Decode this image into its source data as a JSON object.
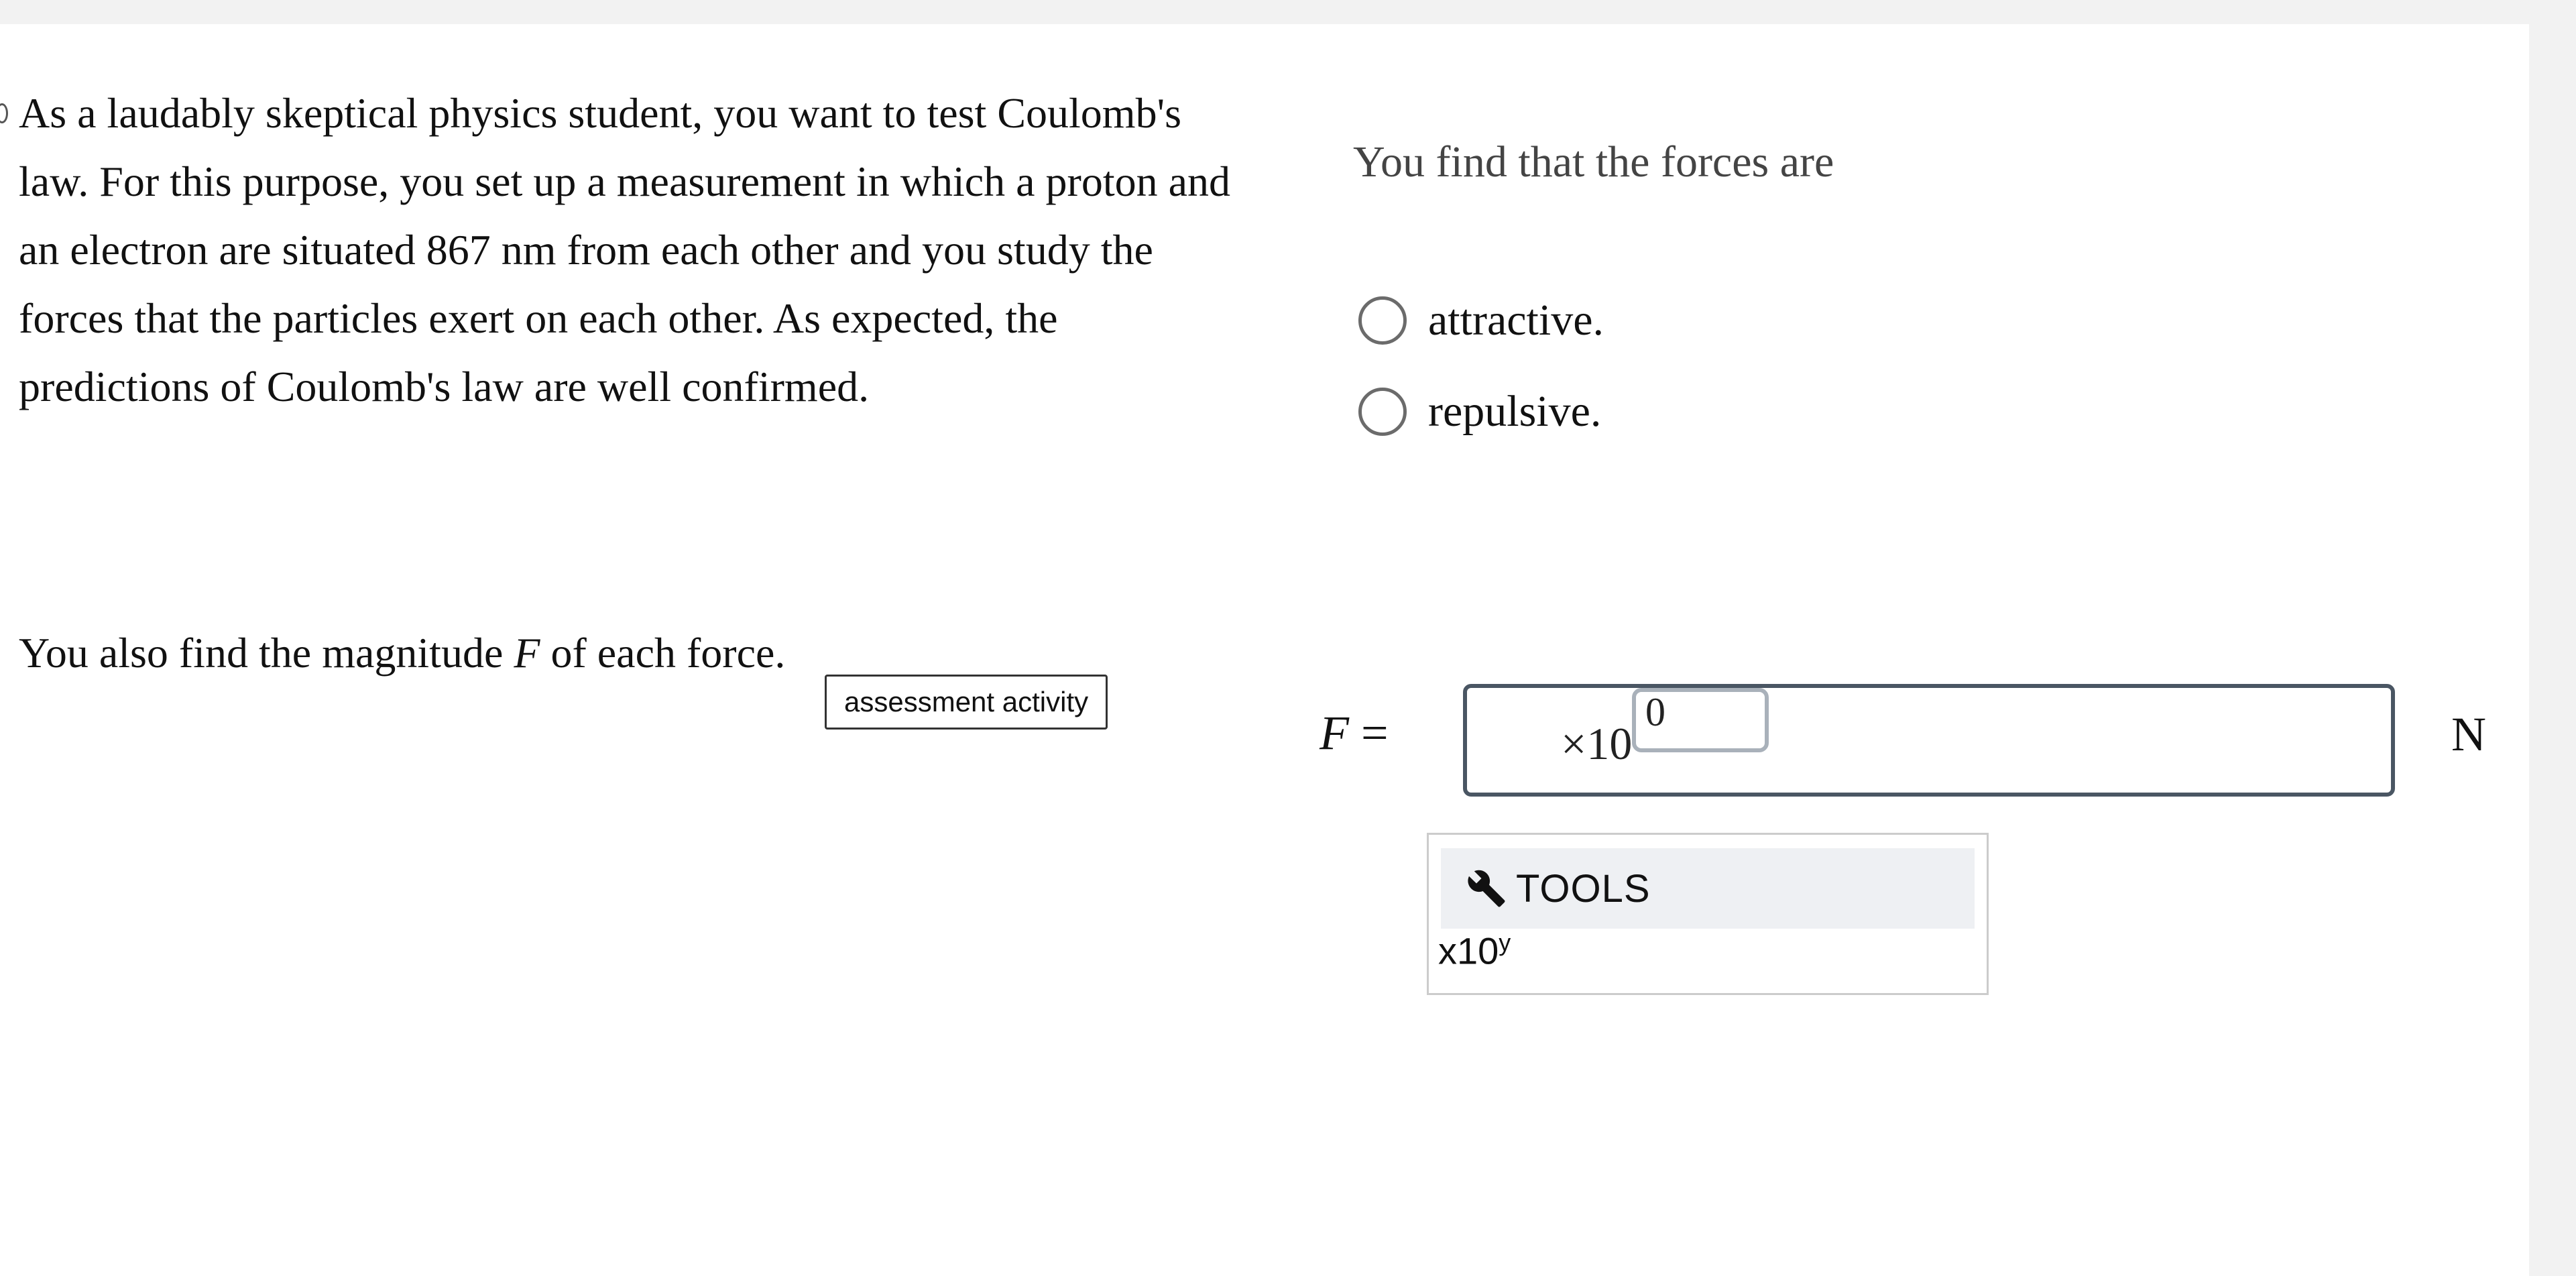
{
  "question": {
    "paragraph": "As a laudably skeptical physics student, you want to test Coulomb's law. For this purpose, you set up a measurement in which a proton and an electron are situated 867 nm from each other and you study the forces that the particles exert on each other. As expected, the predictions of Coulomb's law are well confirmed.",
    "magnitude_before": "You also find the magnitude ",
    "magnitude_var": "F",
    "magnitude_after": " of each force."
  },
  "tooltip": {
    "text": "assessment activity"
  },
  "forces": {
    "prompt": "You find that the forces are",
    "options": [
      {
        "label": "attractive.",
        "selected": false
      },
      {
        "label": "repulsive.",
        "selected": false
      }
    ]
  },
  "answer": {
    "variable": "F",
    "equals": "=",
    "times_ten": "×10",
    "exponent": "0",
    "unit": "N"
  },
  "tools": {
    "title": "TOOLS",
    "icon": "wrench-icon",
    "sci_base": "x10",
    "sci_sup": "y"
  },
  "colors": {
    "background": "#f2f2f2",
    "card": "#ffffff",
    "input_border": "#4a5663",
    "tools_header": "#eef0f3"
  }
}
